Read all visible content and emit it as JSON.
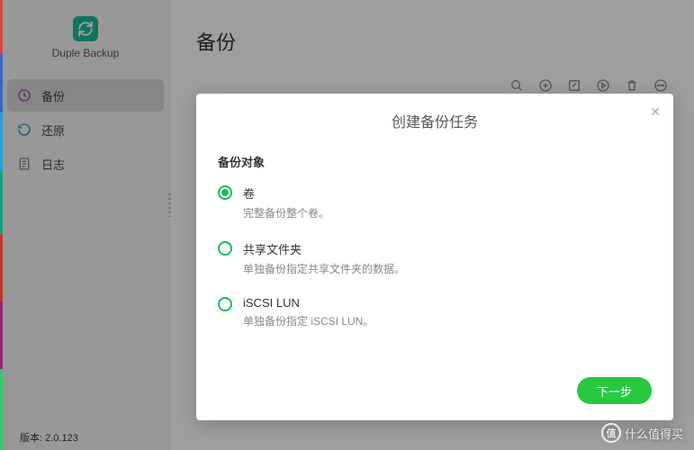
{
  "app": {
    "name": "Duple Backup",
    "version_label": "版本:",
    "version": "2.0.123"
  },
  "page": {
    "title": "备份"
  },
  "sidebar": {
    "items": [
      {
        "icon": "clock-icon",
        "label": "备份",
        "active": true
      },
      {
        "icon": "refresh-icon",
        "label": "还原",
        "active": false
      },
      {
        "icon": "log-icon",
        "label": "日志",
        "active": false
      }
    ]
  },
  "toolbar": {
    "icons": [
      "search-icon",
      "add-icon",
      "edit-icon",
      "play-icon",
      "trash-icon",
      "more-icon"
    ]
  },
  "modal": {
    "title": "创建备份任务",
    "section_label": "备份对象",
    "options": [
      {
        "title": "卷",
        "desc": "完整备份整个卷。",
        "selected": true
      },
      {
        "title": "共享文件夹",
        "desc": "单独备份指定共享文件夹的数据。",
        "selected": false
      },
      {
        "title": "iSCSI LUN",
        "desc": "单独备份指定 iSCSI LUN。",
        "selected": false
      }
    ],
    "next_button": "下一步"
  },
  "watermark": {
    "badge": "值",
    "text": "什么值得买"
  }
}
